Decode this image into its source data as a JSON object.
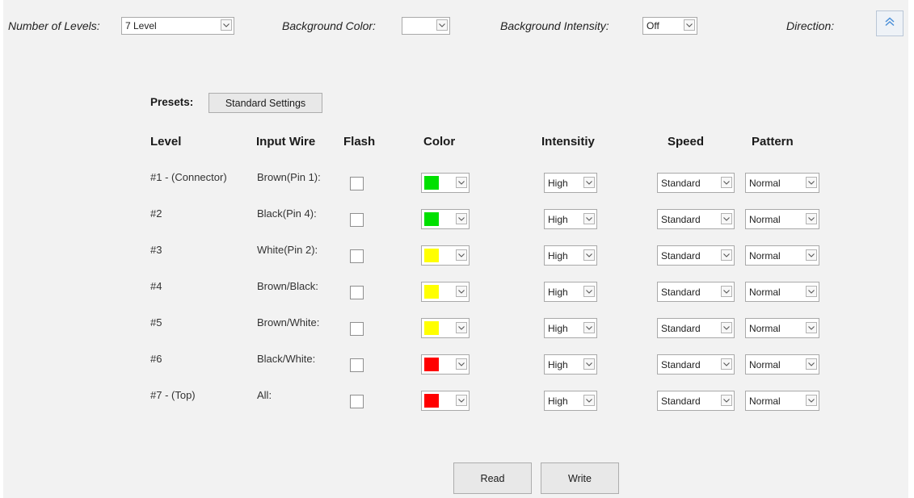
{
  "top": {
    "levels_label": "Number of Levels:",
    "levels_value": "7 Level",
    "bg_color_label": "Background  Color:",
    "bg_color_value": "",
    "bg_intensity_label": "Background  Intensity:",
    "bg_intensity_value": "Off",
    "direction_label": "Direction:",
    "direction_icon": "double-chevron-up-icon"
  },
  "presets": {
    "label": "Presets:",
    "button": "Standard Settings"
  },
  "headers": {
    "level": "Level",
    "wire": "Input Wire",
    "flash": "Flash",
    "color": "Color",
    "intensity": "Intensitiy",
    "speed": "Speed",
    "pattern": "Pattern"
  },
  "rows": [
    {
      "level": "#1 - (Connector)",
      "wire": "Brown(Pin 1):",
      "flash": false,
      "color": "#00e000",
      "intensity": "High",
      "speed": "Standard",
      "pattern": "Normal"
    },
    {
      "level": "#2",
      "wire": "Black(Pin 4):",
      "flash": false,
      "color": "#00e000",
      "intensity": "High",
      "speed": "Standard",
      "pattern": "Normal"
    },
    {
      "level": "#3",
      "wire": "White(Pin 2):",
      "flash": false,
      "color": "#ffff00",
      "intensity": "High",
      "speed": "Standard",
      "pattern": "Normal"
    },
    {
      "level": "#4",
      "wire": "Brown/Black:",
      "flash": false,
      "color": "#ffff00",
      "intensity": "High",
      "speed": "Standard",
      "pattern": "Normal"
    },
    {
      "level": "#5",
      "wire": "Brown/White:",
      "flash": false,
      "color": "#ffff00",
      "intensity": "High",
      "speed": "Standard",
      "pattern": "Normal"
    },
    {
      "level": "#6",
      "wire": "Black/White:",
      "flash": false,
      "color": "#ff0000",
      "intensity": "High",
      "speed": "Standard",
      "pattern": "Normal"
    },
    {
      "level": "#7 - (Top)",
      "wire": "All:",
      "flash": false,
      "color": "#ff0000",
      "intensity": "High",
      "speed": "Standard",
      "pattern": "Normal"
    }
  ],
  "footer": {
    "read": "Read",
    "write": "Write"
  }
}
